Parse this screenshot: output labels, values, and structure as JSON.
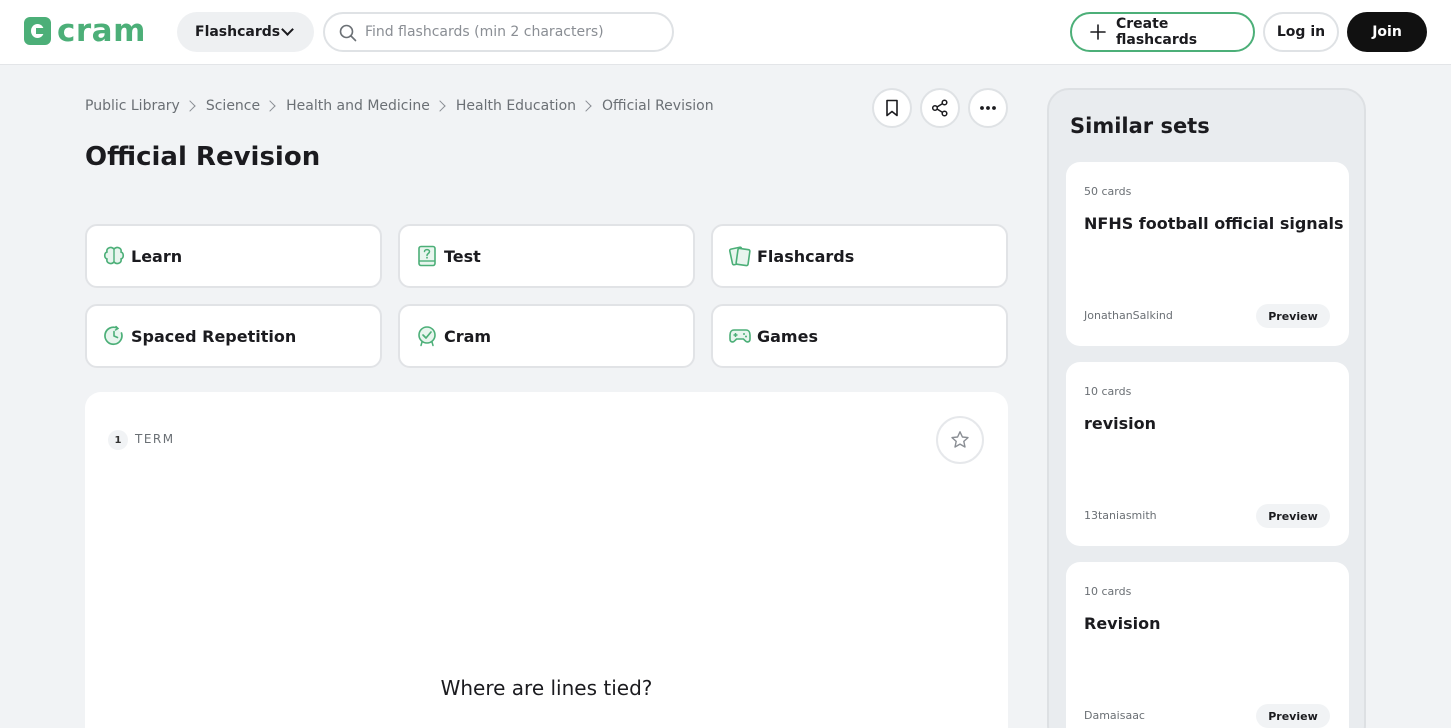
{
  "header": {
    "logo_text": "cram",
    "dropdown_label": "Flashcards",
    "search_placeholder": "Find flashcards (min 2 characters)",
    "create_label": "Create flashcards",
    "login_label": "Log in",
    "join_label": "Join"
  },
  "breadcrumb": [
    "Public Library",
    "Science",
    "Health and Medicine",
    "Health Education",
    "Official Revision"
  ],
  "page_title": "Official Revision",
  "modes": [
    {
      "label": "Learn",
      "icon": "brain-icon"
    },
    {
      "label": "Test",
      "icon": "test-icon"
    },
    {
      "label": "Flashcards",
      "icon": "flashcards-icon"
    },
    {
      "label": "Spaced Repetition",
      "icon": "spaced-repetition-icon"
    },
    {
      "label": "Cram",
      "icon": "cram-icon"
    },
    {
      "label": "Games",
      "icon": "gamepad-icon"
    }
  ],
  "card": {
    "number": "1",
    "label": "TERM",
    "text": "Where are lines tied?"
  },
  "sidebar": {
    "title": "Similar sets",
    "sets": [
      {
        "count": "50 cards",
        "title": "NFHS football official signals",
        "author": "JonathanSalkind",
        "preview": "Preview"
      },
      {
        "count": "10 cards",
        "title": "revision",
        "author": "13taniasmith",
        "preview": "Preview"
      },
      {
        "count": "10 cards",
        "title": "Revision",
        "author": "Damaisaac",
        "preview": "Preview"
      }
    ]
  },
  "colors": {
    "accent": "#4caf78",
    "dark": "#111111",
    "background": "#f1f3f5"
  }
}
